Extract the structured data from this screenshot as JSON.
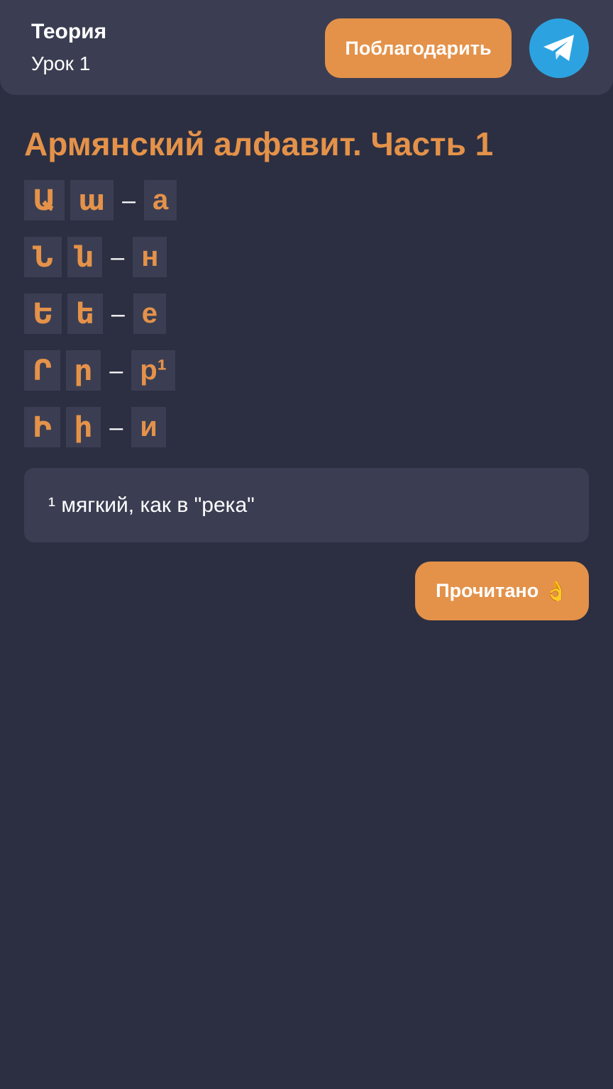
{
  "header": {
    "title": "Теория",
    "subtitle": "Урок 1",
    "thank_label": "Поблагодарить",
    "telegram_icon": "telegram-icon"
  },
  "lesson": {
    "title": "Армянский алфавит. Часть 1",
    "rows": [
      {
        "upper": "Ա",
        "lower": "ա",
        "dash": "–",
        "translit": "а"
      },
      {
        "upper": "Ն",
        "lower": "ն",
        "dash": "–",
        "translit": "н"
      },
      {
        "upper": "Ե",
        "lower": "ե",
        "dash": "–",
        "translit": "е"
      },
      {
        "upper": "Ր",
        "lower": "ր",
        "dash": "–",
        "translit": "р¹"
      },
      {
        "upper": "Ի",
        "lower": "ի",
        "dash": "–",
        "translit": "и"
      }
    ],
    "note": "¹ мягкий, как в \"река\""
  },
  "actions": {
    "read_label": "Прочитано",
    "read_emoji": "👌"
  },
  "colors": {
    "background": "#2c2f41",
    "panel": "#3b3e52",
    "accent": "#e4924a",
    "telegram": "#2ca3e0"
  }
}
